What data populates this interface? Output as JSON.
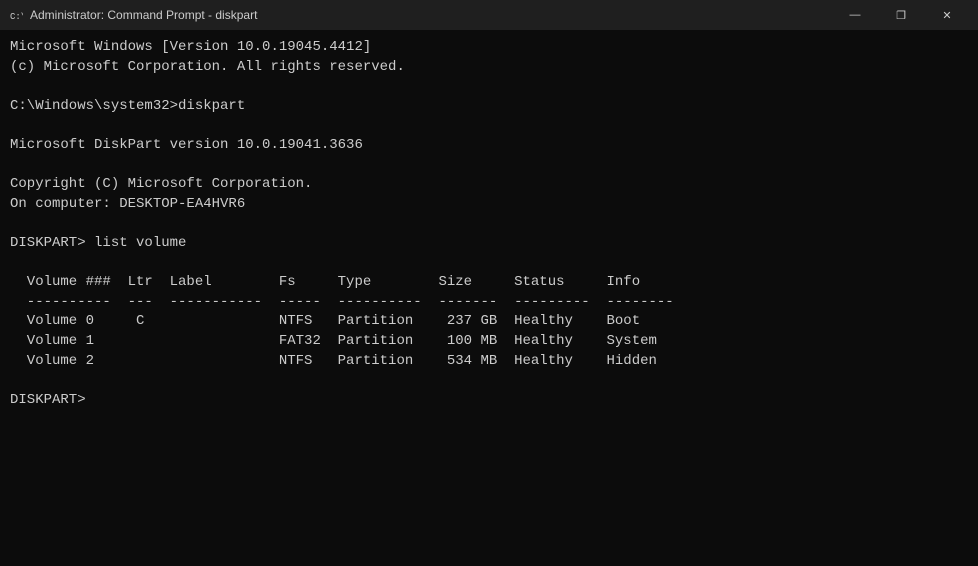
{
  "titleBar": {
    "icon": "cmd-icon",
    "title": "Administrator: Command Prompt - diskpart",
    "minimize": "—",
    "maximize": "❐",
    "close": "✕"
  },
  "console": {
    "lines": [
      "Microsoft Windows [Version 10.0.19045.4412]",
      "(c) Microsoft Corporation. All rights reserved.",
      "",
      "C:\\Windows\\system32>diskpart",
      "",
      "Microsoft DiskPart version 10.0.19041.3636",
      "",
      "Copyright (C) Microsoft Corporation.",
      "On computer: DESKTOP-EA4HVR6",
      "",
      "DISKPART> list volume",
      "",
      "  Volume ###  Ltr  Label        Fs     Type        Size     Status     Info",
      "  ----------  ---  -----------  -----  ----------  -------  ---------  --------",
      "  Volume 0     C                NTFS   Partition    237 GB  Healthy    Boot",
      "  Volume 1                      FAT32  Partition    100 MB  Healthy    System",
      "  Volume 2                      NTFS   Partition    534 MB  Healthy    Hidden",
      "",
      "DISKPART> "
    ]
  }
}
